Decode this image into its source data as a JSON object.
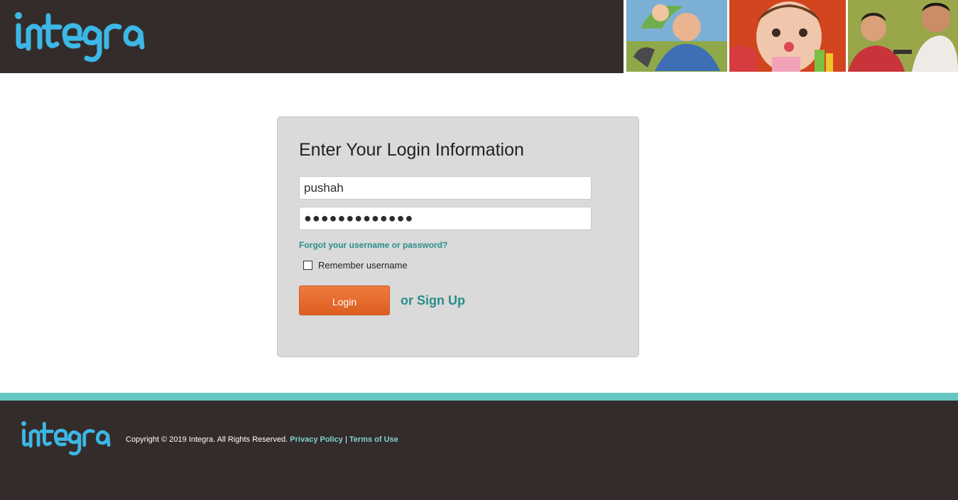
{
  "brand": {
    "logo_text": "integra",
    "logo_color": "#3cb7e6",
    "logo_dark_color": "#1d8fc6",
    "header_bg": "#342c2b",
    "accent_teal": "#2a8d8c",
    "accent_orange": "#e2692b"
  },
  "login": {
    "title": "Enter Your Login Information",
    "username_value": "pushah",
    "password_value": "●●●●●●●●●●●●●",
    "forgot_link": "Forgot your username or password?",
    "remember_label": "Remember username",
    "remember_checked": false,
    "login_button": "Login",
    "signup_link": "or Sign Up"
  },
  "footer": {
    "copyright": "Copyright © 2019 Integra. All Rights Reserved.",
    "privacy_link": "Privacy Policy",
    "separator": "|",
    "terms_link": "Terms of Use"
  },
  "icons": {
    "checkbox": "checkbox-unchecked-icon",
    "logo": "integra-logo-icon"
  }
}
